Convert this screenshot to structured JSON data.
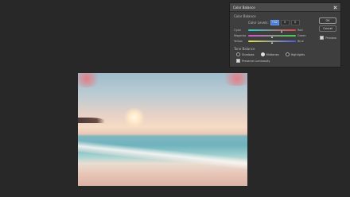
{
  "dialog": {
    "title": "Color Balance",
    "color_balance_label": "Color Balance",
    "color_levels_label": "Color Levels:",
    "levels": [
      "+42",
      "0",
      "0"
    ],
    "sliders": [
      {
        "left": "Cyan",
        "right": "Red",
        "value": 42
      },
      {
        "left": "Magenta",
        "right": "Green",
        "value": 0
      },
      {
        "left": "Yellow",
        "right": "Blue",
        "value": 0
      }
    ],
    "tone_balance_label": "Tone Balance",
    "tones": [
      {
        "label": "Shadows",
        "selected": false
      },
      {
        "label": "Midtones",
        "selected": true
      },
      {
        "label": "Highlights",
        "selected": false
      }
    ],
    "preserve_luminosity_label": "Preserve Luminosity",
    "preserve_luminosity_checked": true,
    "ok_label": "OK",
    "cancel_label": "Cancel",
    "preview_label": "Preview",
    "preview_checked": true
  },
  "canvas": {
    "image_icon": "beach-sunset-photo"
  },
  "colors": {
    "app_bg": "#282828",
    "dialog_bg": "#3e3e3e",
    "active_field": "#4a7bd0"
  }
}
